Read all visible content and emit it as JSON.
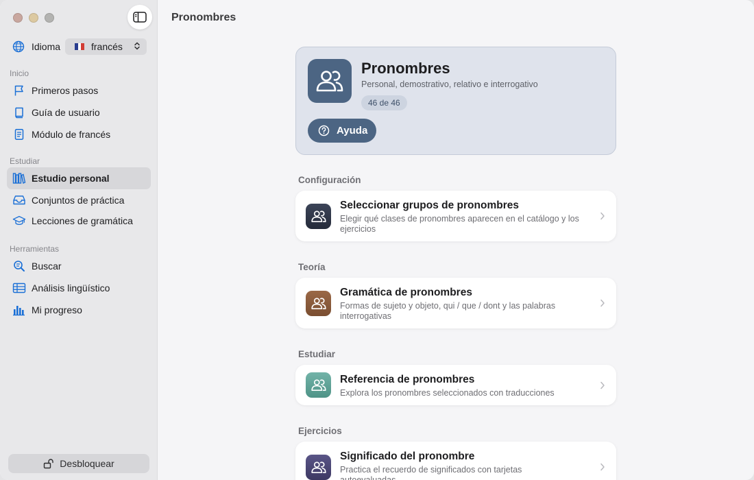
{
  "sidebar": {
    "language_label": "Idioma",
    "language_value": "francés",
    "sections": {
      "inicio": "Inicio",
      "estudiar": "Estudiar",
      "herramientas": "Herramientas"
    },
    "items": {
      "primeros_pasos": "Primeros pasos",
      "guia_usuario": "Guía de usuario",
      "modulo_frances": "Módulo de francés",
      "estudio_personal": "Estudio personal",
      "conjuntos_practica": "Conjuntos de práctica",
      "lecciones_gramatica": "Lecciones de gramática",
      "buscar": "Buscar",
      "analisis_linguistico": "Análisis lingüístico",
      "mi_progreso": "Mi progreso"
    },
    "unlock_label": "Desbloquear"
  },
  "main": {
    "title": "Pronombres",
    "hero": {
      "title": "Pronombres",
      "subtitle": "Personal, demostrativo, relativo e interrogativo",
      "badge": "46 de 46",
      "help_label": "Ayuda"
    },
    "groups": {
      "configuracion": "Configuración",
      "teoria": "Teoría",
      "estudiar": "Estudiar",
      "ejercicios": "Ejercicios"
    },
    "cards": {
      "seleccionar": {
        "title": "Seleccionar grupos de pronombres",
        "desc": "Elegir qué clases de pronombres aparecen en el catálogo y los ejercicios"
      },
      "gramatica": {
        "title": "Gramática de pronombres",
        "desc": "Formas de sujeto y objeto, qui / que / dont y las palabras interrogativas"
      },
      "referencia": {
        "title": "Referencia de pronombres",
        "desc": "Explora los pronombres seleccionados con traducciones"
      },
      "significado": {
        "title": "Significado del pronombre",
        "desc": "Practica el recuerdo de significados con tarjetas autoevaluadas"
      }
    }
  },
  "colors": {
    "accent": "#1a6fd6",
    "hero_blue": "#4c6583",
    "card_dark": "#2f3647",
    "card_brown": "#8a5a3b",
    "card_teal": "#5fa398",
    "card_purple": "#4a4673"
  },
  "icons": {
    "sidebar_toggle": "sidebar-toggle-icon",
    "language": "globe-icon",
    "pronouns": "people-icon",
    "help": "question-circle-icon",
    "unlock": "lock-open-icon"
  }
}
